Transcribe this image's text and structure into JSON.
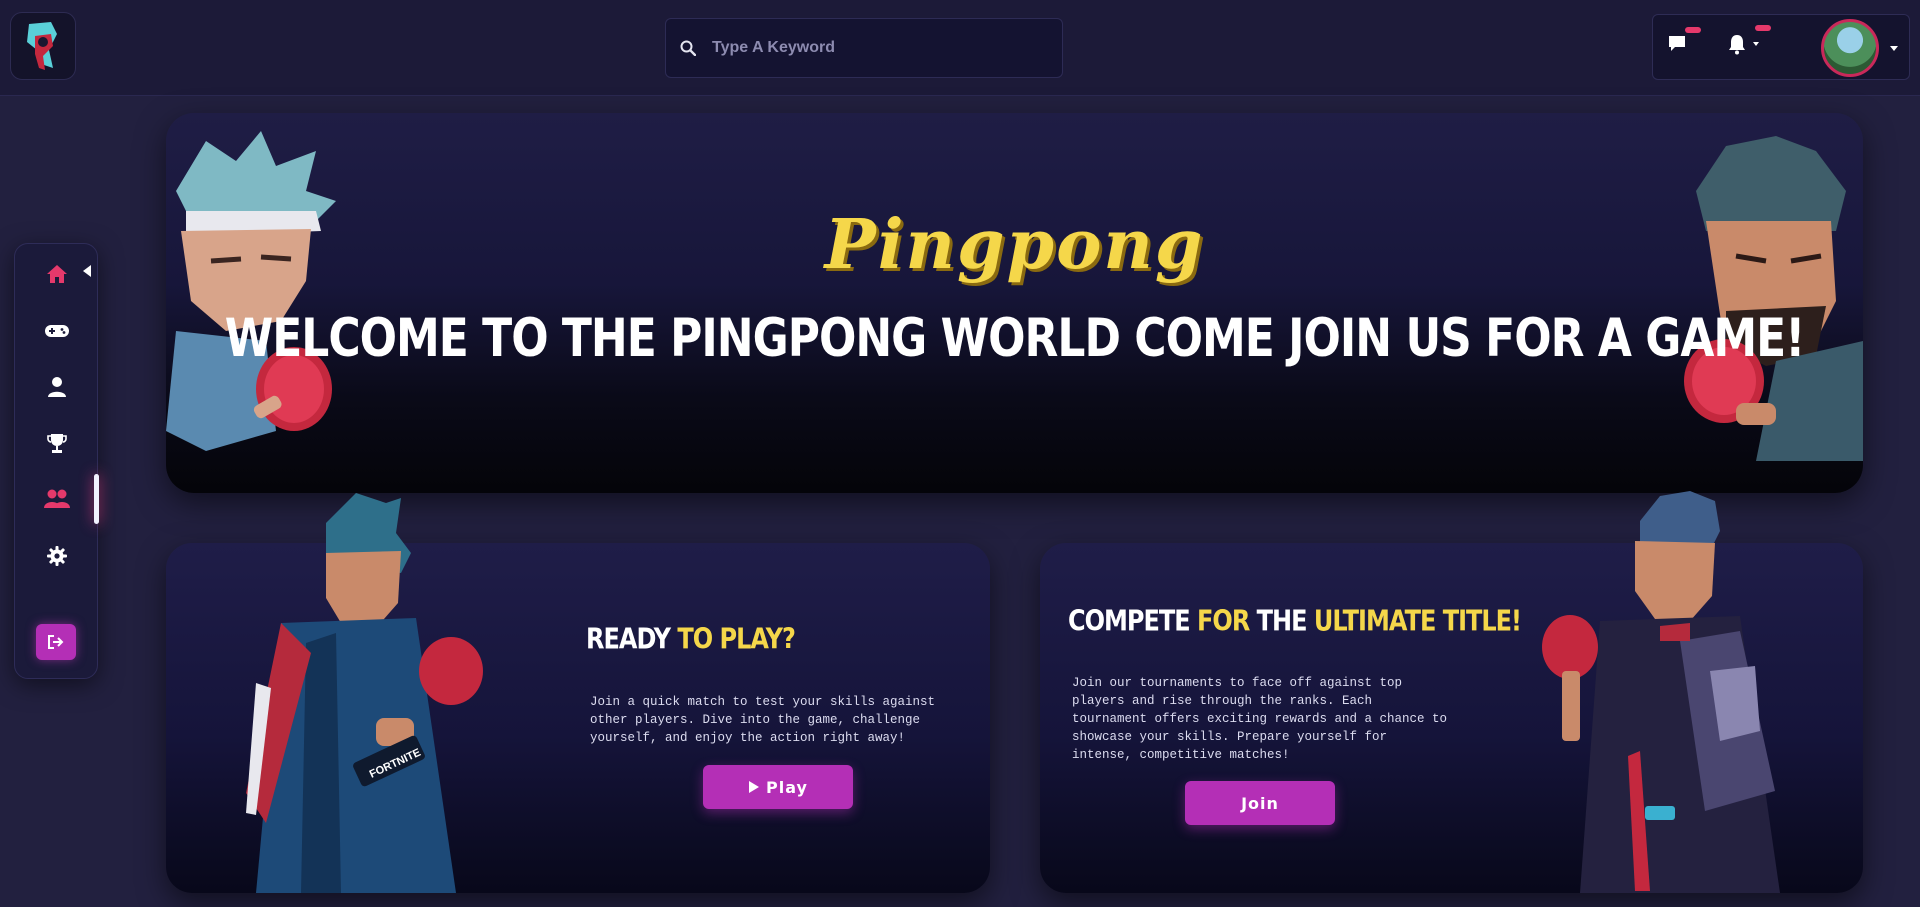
{
  "header": {
    "search": {
      "placeholder": "Type A Keyword"
    }
  },
  "hero": {
    "title": "Pingpong",
    "subtitle": "Welcome to the pingpong world come join us for a game!"
  },
  "cards": {
    "play": {
      "heading_white": "Ready",
      "heading_yellow": "to Play?",
      "text": "Join a quick match to test your skills against other players. Dive into the game, challenge yourself, and enjoy the action right away!",
      "button_label": "Play",
      "character_label": "FORTNITE"
    },
    "tournament": {
      "heading_white_1": "Compete",
      "heading_yellow_1": "for",
      "heading_white_2": "the",
      "heading_yellow_2": "Ultimate Title!",
      "text": "Join our tournaments to face off against top players and rise through the ranks. Each tournament offers exciting rewards and a chance to showcase your skills. Prepare yourself for intense, competitive matches!",
      "button_label": "Join"
    }
  },
  "sidebar": {
    "items": [
      {
        "icon": "home-icon",
        "active": true
      },
      {
        "icon": "gamepad-icon"
      },
      {
        "icon": "user-icon"
      },
      {
        "icon": "trophy-icon"
      },
      {
        "icon": "users-icon"
      },
      {
        "icon": "gear-icon"
      }
    ],
    "logout_icon": "logout-icon"
  },
  "colors": {
    "background": "#22203f",
    "accent": "#b42fb6",
    "title_yellow": "#f5d74a",
    "active_pink": "#e5396b"
  }
}
